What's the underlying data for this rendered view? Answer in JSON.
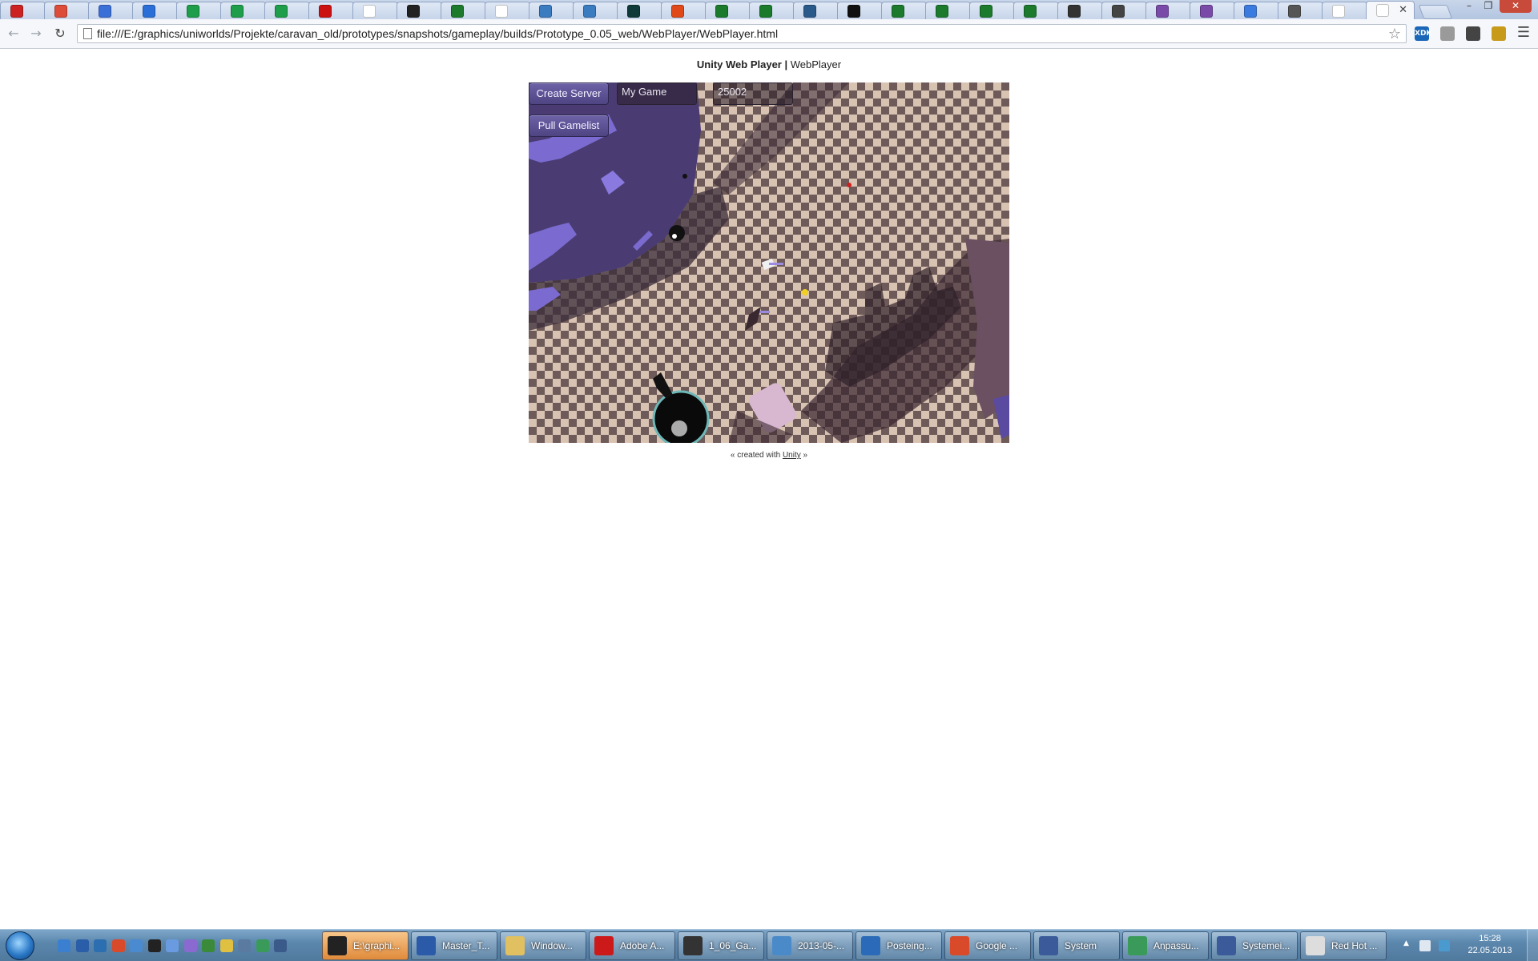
{
  "browser": {
    "tabs": [
      {
        "name": "tab-1",
        "color": "#cc2222"
      },
      {
        "name": "tab-2",
        "color": "#dd4b39"
      },
      {
        "name": "tab-3",
        "color": "#3a6fd8"
      },
      {
        "name": "tab-4",
        "color": "#2a6fd8"
      },
      {
        "name": "tab-5",
        "color": "#1e9e4a"
      },
      {
        "name": "tab-6",
        "color": "#1e9e4a"
      },
      {
        "name": "tab-7",
        "color": "#1e9e4a"
      },
      {
        "name": "tab-8",
        "color": "#cc1111"
      },
      {
        "name": "tab-9",
        "color": "#ffffff"
      },
      {
        "name": "tab-10",
        "color": "#222222"
      },
      {
        "name": "tab-11",
        "color": "#1b7a2c"
      },
      {
        "name": "tab-12",
        "color": "#ffffff"
      },
      {
        "name": "tab-13",
        "color": "#3b7bbf"
      },
      {
        "name": "tab-14",
        "color": "#3b7bbf"
      },
      {
        "name": "tab-15",
        "color": "#103a3a"
      },
      {
        "name": "tab-16",
        "color": "#e04a1a"
      },
      {
        "name": "tab-17",
        "color": "#1b7a2c"
      },
      {
        "name": "tab-18",
        "color": "#1b7a2c"
      },
      {
        "name": "tab-19",
        "color": "#2a5a8a"
      },
      {
        "name": "tab-20",
        "color": "#111111"
      },
      {
        "name": "tab-21",
        "color": "#1b7a2c"
      },
      {
        "name": "tab-22",
        "color": "#1b7a2c"
      },
      {
        "name": "tab-23",
        "color": "#1b7a2c"
      },
      {
        "name": "tab-24",
        "color": "#1b7a2c"
      },
      {
        "name": "tab-25",
        "color": "#333333"
      },
      {
        "name": "tab-26",
        "color": "#444444"
      },
      {
        "name": "tab-27",
        "color": "#7a4aa8"
      },
      {
        "name": "tab-28",
        "color": "#7a4aa8"
      },
      {
        "name": "tab-29",
        "color": "#3b7bdf"
      },
      {
        "name": "tab-30",
        "color": "#555555"
      },
      {
        "name": "tab-31",
        "color": "#ffffff"
      },
      {
        "name": "tab-32",
        "color": "#ffffff",
        "active": true
      }
    ],
    "tab_close": "✕",
    "window_controls": {
      "minimize": "–",
      "maximize": "❐",
      "close": "✕"
    },
    "nav": {
      "back": "←",
      "forward": "→",
      "reload": "↻"
    },
    "address": "file:///E:/graphics/uniworlds/Projekte/caravan_old/prototypes/snapshots/gameplay/builds/Prototype_0.05_web/WebPlayer/WebPlayer.html",
    "bookmark_star": "☆",
    "extensions": [
      {
        "name": "xdk-extension-icon",
        "label": "XDK",
        "color": "#1a66b8"
      },
      {
        "name": "extension-2-icon",
        "label": "",
        "color": "#9a9a9a"
      },
      {
        "name": "extension-3-icon",
        "label": "",
        "color": "#444444"
      },
      {
        "name": "extension-4-icon",
        "label": "",
        "color": "#c79a1a"
      }
    ],
    "menu_icon": "☰"
  },
  "page": {
    "header_bold": "Unity Web Player |",
    "header_rest": " WebPlayer",
    "game": {
      "create_server_label": "Create Server",
      "pull_gamelist_label": "Pull Gamelist",
      "game_name_value": "My Game",
      "port_value": "25002"
    },
    "footer_prefix": "« created with ",
    "footer_link": "Unity",
    "footer_suffix": " »"
  },
  "taskbar": {
    "quicklaunch_colors": [
      "#3a7fd0",
      "#2b5ea8",
      "#2b6fb0",
      "#d84a2a",
      "#4a8ad0",
      "#222222",
      "#6a9ae0",
      "#8a6ad0",
      "#3a8a3a",
      "#e0c040",
      "#5a7aa0",
      "#3a9a5a",
      "#3a5a8a"
    ],
    "tasks": [
      {
        "label": "E:\\graphi...",
        "icon_color": "#222222",
        "active": true
      },
      {
        "label": "Master_T...",
        "icon_color": "#2a5aa8",
        "active": false
      },
      {
        "label": "Window...",
        "icon_color": "#e0c060",
        "active": false
      },
      {
        "label": "Adobe A...",
        "icon_color": "#cc1a1a",
        "active": false
      },
      {
        "label": "1_06_Ga...",
        "icon_color": "#333333",
        "active": false
      },
      {
        "label": "2013-05-...",
        "icon_color": "#4a8ac8",
        "active": false
      },
      {
        "label": "Posteing...",
        "icon_color": "#2a6ab8",
        "active": false
      },
      {
        "label": "Google ...",
        "icon_color": "#d84a2a",
        "active": false
      },
      {
        "label": "System",
        "icon_color": "#3a5a9a",
        "active": false
      },
      {
        "label": "Anpassu...",
        "icon_color": "#3a9a5a",
        "active": false
      },
      {
        "label": "Systemei...",
        "icon_color": "#3a5a9a",
        "active": false
      },
      {
        "label": "Red Hot ...",
        "icon_color": "#dddddd",
        "active": false
      }
    ],
    "tray_arrow": "▲",
    "clock_time": "15:28",
    "clock_date": "22.05.2013"
  }
}
